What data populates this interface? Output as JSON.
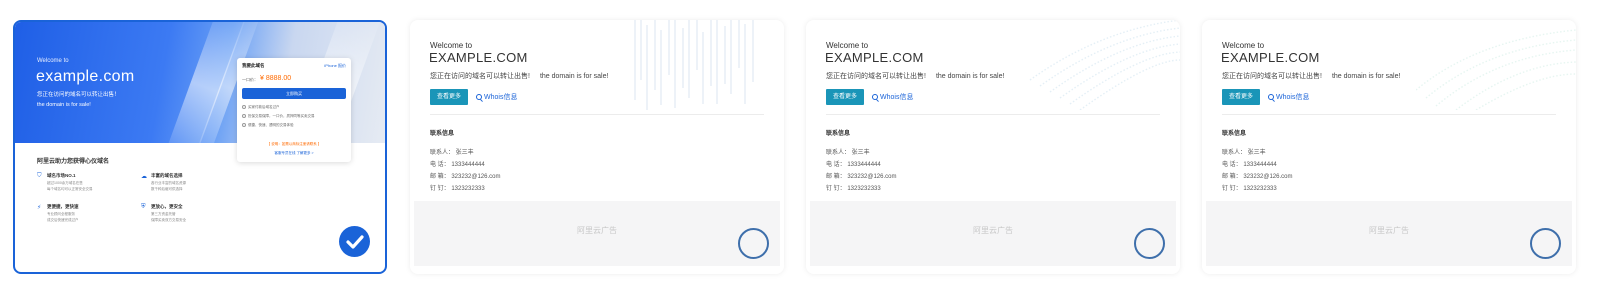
{
  "colors": {
    "accent": "#1a63d8",
    "button_teal": "#1a95b8",
    "price_orange": "#ff6a00"
  },
  "card1": {
    "welcome": "Welcome to",
    "domain": "example.com",
    "subtitle_cn": "您正在访问的域名可以转让出售！",
    "subtitle_en": "the domain is for sale!",
    "panel": {
      "title": "我要此域名",
      "link": "iPhone 报价",
      "price_label": "一口价：",
      "price": "¥ 8888.00",
      "button": "立即购买",
      "features": [
        "买家付款后域名过户",
        "担保交易保障，一口价，质押同等买卖交易",
        "便捷、快速、透明的交易体验"
      ],
      "footer1": "【 说明：如需以商标注册请联系 】",
      "footer2": "客服专员在线 了解更多 >"
    },
    "section_title": "阿里云助力您获得心仪域名",
    "features": [
      {
        "icon": "shield-icon",
        "title": "域名市场NO.1",
        "desc1": "超过1000余万域名在售",
        "desc2": "每个域名均可以正常安全交易"
      },
      {
        "icon": "cloud-icon",
        "title": "丰富的域名选择",
        "desc1": "各行业丰富的域名资源",
        "desc2": "数千种后缀可供选择"
      },
      {
        "icon": "lightning-icon",
        "title": "更便捷，更快速",
        "desc1": "专业顾问全程服务",
        "desc2": "成交后快速完成过户"
      },
      {
        "icon": "lock-icon",
        "title": "更放心，更安全",
        "desc1": "第三方资金托管",
        "desc2": "保障买卖双方交易安全"
      }
    ]
  },
  "template_cards": [
    {
      "welcome": "Welcome to",
      "domain": "EXAMPLE.COM",
      "subtitle_cn": "您正在访问的域名可以转让出售!",
      "subtitle_en": "the domain is for sale!",
      "more_button": "查看更多",
      "whois_link": "Whois信息",
      "contact_title": "联系信息",
      "contact_lines": [
        "联系人：  张三丰",
        "电    话：  1333444444",
        "邮    箱：  323232@126.com",
        "钉    钉：  1323232333"
      ],
      "ad_text": "阿里云广告"
    },
    {
      "welcome": "Welcome to",
      "domain": "EXAMPLE.COM",
      "subtitle_cn": "您正在访问的域名可以转让出售!",
      "subtitle_en": "the domain is for sale!",
      "more_button": "查看更多",
      "whois_link": "Whois信息",
      "contact_title": "联系信息",
      "contact_lines": [
        "联系人：  张三丰",
        "电    话：  1333444444",
        "邮    箱：  323232@126.com",
        "钉    钉：  1323232333"
      ],
      "ad_text": "阿里云广告"
    },
    {
      "welcome": "Welcome to",
      "domain": "EXAMPLE.COM",
      "subtitle_cn": "您正在访问的域名可以转让出售!",
      "subtitle_en": "the domain is for sale!",
      "more_button": "查看更多",
      "whois_link": "Whois信息",
      "contact_title": "联系信息",
      "contact_lines": [
        "联系人：  张三丰",
        "电    话：  1333444444",
        "邮    箱：  323232@126.com",
        "钉    钉：  1323232333"
      ],
      "ad_text": "阿里云广告"
    }
  ],
  "selection": {
    "selected_index": 0,
    "checked_icon": "checkmark-icon",
    "unchecked_icon": "empty-circle-icon"
  }
}
